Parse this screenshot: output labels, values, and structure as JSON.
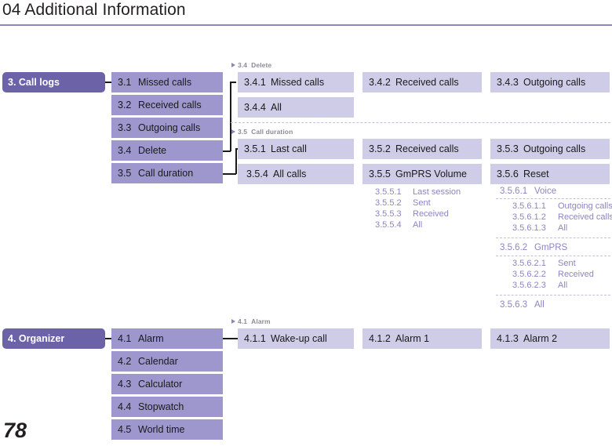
{
  "page": {
    "title": "04 Additional Information",
    "number": "78"
  },
  "sections": [
    {
      "id": "call-logs",
      "root": "3. Call logs",
      "level2": [
        {
          "num": "3.1",
          "label": "Missed calls"
        },
        {
          "num": "3.2",
          "label": "Received calls"
        },
        {
          "num": "3.3",
          "label": "Outgoing calls"
        },
        {
          "num": "3.4",
          "label": "Delete"
        },
        {
          "num": "3.5",
          "label": "Call duration"
        }
      ],
      "groups": [
        {
          "head_num": "3.4",
          "head_label": "Delete",
          "items": [
            {
              "num": "3.4.1",
              "label": "Missed calls"
            },
            {
              "num": "3.4.2",
              "label": "Received calls"
            },
            {
              "num": "3.4.3",
              "label": "Outgoing calls"
            },
            {
              "num": "3.4.4",
              "label": "All"
            }
          ]
        },
        {
          "head_num": "3.5",
          "head_label": "Call duration",
          "items": [
            {
              "num": "3.5.1",
              "label": "Last call"
            },
            {
              "num": "3.5.2",
              "label": "Received calls"
            },
            {
              "num": "3.5.3",
              "label": "Outgoing calls"
            },
            {
              "num": "3.5.4",
              "label": "All calls"
            },
            {
              "num": "3.5.5",
              "label": "GmPRS Volume"
            },
            {
              "num": "3.5.6",
              "label": "Reset"
            }
          ]
        }
      ],
      "gmprs_volume_children": [
        {
          "num": "3.5.5.1",
          "label": "Last session"
        },
        {
          "num": "3.5.5.2",
          "label": "Sent"
        },
        {
          "num": "3.5.5.3",
          "label": "Received"
        },
        {
          "num": "3.5.5.4",
          "label": "All"
        }
      ],
      "reset_children": [
        {
          "num": "3.5.6.1",
          "label": "Voice"
        },
        {
          "num": "3.5.6.1.1",
          "label": "Outgoing calls"
        },
        {
          "num": "3.5.6.1.2",
          "label": "Received calls"
        },
        {
          "num": "3.5.6.1.3",
          "label": "All"
        },
        {
          "num": "3.5.6.2",
          "label": "GmPRS"
        },
        {
          "num": "3.5.6.2.1",
          "label": "Sent"
        },
        {
          "num": "3.5.6.2.2",
          "label": "Received"
        },
        {
          "num": "3.5.6.2.3",
          "label": "All"
        },
        {
          "num": "3.5.6.3",
          "label": "All"
        }
      ]
    },
    {
      "id": "organizer",
      "root": "4. Organizer",
      "level2": [
        {
          "num": "4.1",
          "label": "Alarm"
        },
        {
          "num": "4.2",
          "label": "Calendar"
        },
        {
          "num": "4.3",
          "label": "Calculator"
        },
        {
          "num": "4.4",
          "label": "Stopwatch"
        },
        {
          "num": "4.5",
          "label": "World time"
        }
      ],
      "groups": [
        {
          "head_num": "4.1",
          "head_label": "Alarm",
          "items": [
            {
              "num": "4.1.1",
              "label": "Wake-up call"
            },
            {
              "num": "4.1.2",
              "label": "Alarm 1"
            },
            {
              "num": "4.1.3",
              "label": "Alarm 2"
            }
          ]
        }
      ]
    }
  ],
  "colors": {
    "accent_rule": "#8f85bd",
    "level1_bg": "#6b62a8",
    "level2_bg": "#9d97cd",
    "level3_bg": "#cfcce8",
    "leaf_text": "#8b85c4",
    "group_head_text": "#8c8c96",
    "dash": "#c3c0da"
  }
}
